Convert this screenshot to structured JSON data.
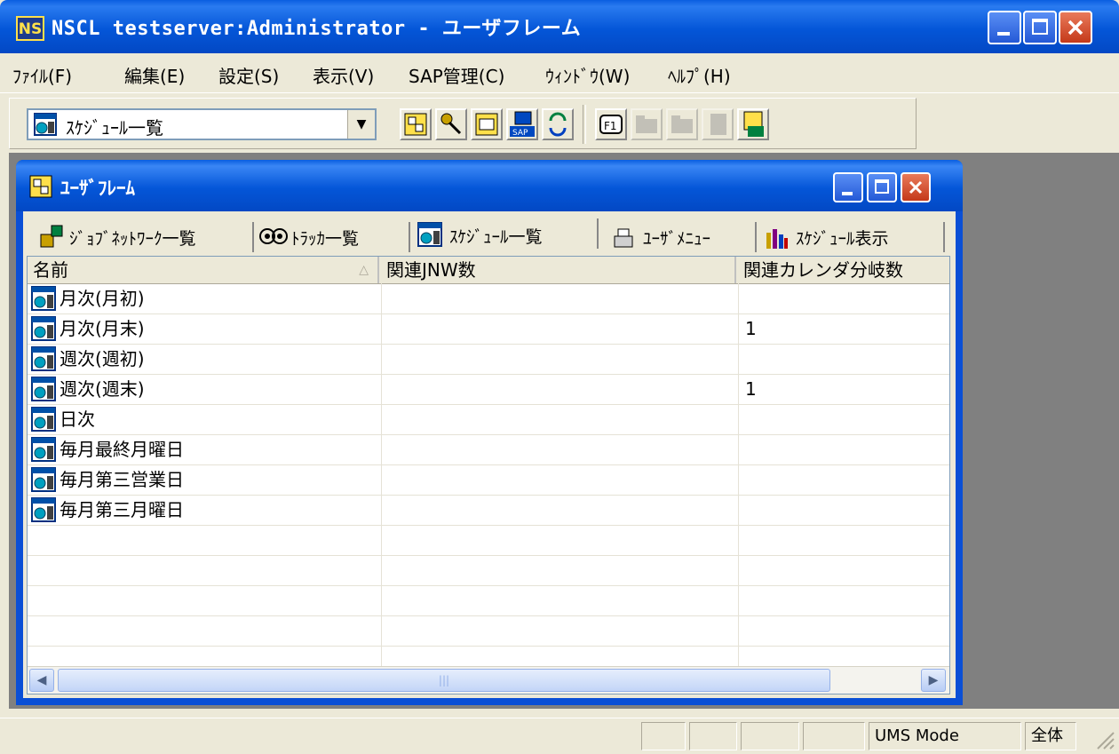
{
  "window": {
    "icon_text": "NS",
    "title": "NSCL testserver:Administrator - ユーザフレーム"
  },
  "menu": [
    "ﾌｧｲﾙ(F)",
    "編集(E)",
    "設定(S)",
    "表示(V)",
    "SAP管理(C)",
    "ｳｨﾝﾄﾞｳ(W)",
    "ﾍﾙﾌﾟ(H)"
  ],
  "toolbar": {
    "combo_value": "ｽｹｼﾞｭｰﾙ一覧"
  },
  "child": {
    "title": "ﾕｰｻﾞﾌﾚｰﾑ"
  },
  "tabs": [
    "ｼﾞｮﾌﾞﾈｯﾄﾜｰｸ一覧",
    "ﾄﾗｯｶ一覧",
    "ｽｹｼﾞｭｰﾙ一覧",
    "ﾕｰｻﾞﾒﾆｭｰ",
    "ｽｹｼﾞｭｰﾙ表示"
  ],
  "selected_tab": "ｽｹｼﾞｭｰﾙ一覧",
  "table": {
    "columns": [
      "名前",
      "関連JNW数",
      "関連カレンダ分岐数"
    ],
    "rows": [
      {
        "name": "月次(月初)",
        "jnw": "",
        "cal": ""
      },
      {
        "name": "月次(月末)",
        "jnw": "",
        "cal": "1"
      },
      {
        "name": "週次(週初)",
        "jnw": "",
        "cal": ""
      },
      {
        "name": "週次(週末)",
        "jnw": "",
        "cal": "1"
      },
      {
        "name": "日次",
        "jnw": "",
        "cal": ""
      },
      {
        "name": "毎月最終月曜日",
        "jnw": "",
        "cal": ""
      },
      {
        "name": "毎月第三営業日",
        "jnw": "",
        "cal": ""
      },
      {
        "name": "毎月第三月曜日",
        "jnw": "",
        "cal": ""
      }
    ]
  },
  "statusbar": {
    "mode": "UMS Mode",
    "scope": "全体"
  },
  "colors": {
    "titlebar_blue": "#0456d8",
    "window_face": "#ece9d8",
    "mdi_background": "#808080",
    "close_red": "#c4391a"
  }
}
